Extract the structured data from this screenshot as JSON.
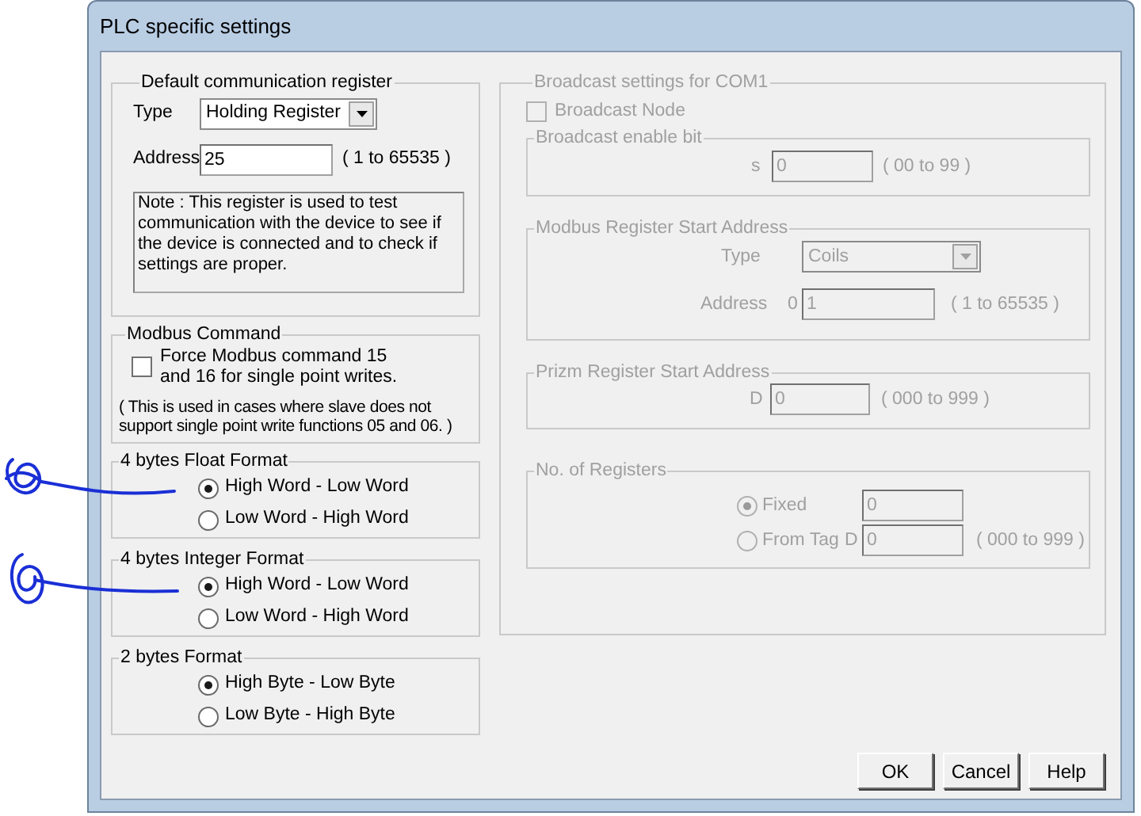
{
  "window": {
    "title": "PLC specific settings"
  },
  "default_register": {
    "title": "Default communication register",
    "type_label": "Type",
    "type_value": "Holding Register",
    "address_label": "Address",
    "address_value": "25",
    "address_range": "( 1 to 65535 )",
    "note": "Note : This register is used to test communication with the device to see if the device is connected and to check if settings are proper."
  },
  "modbus_command": {
    "title": "Modbus Command",
    "checkbox_label": "Force Modbus command 15 and 16 for single point writes.",
    "checked": false,
    "note": "( This is used in cases where slave does not support single point write functions 05 and 06. )"
  },
  "format_groups": [
    {
      "title": "4 bytes Float Format",
      "options": [
        {
          "label": "High Word - Low Word",
          "selected": true
        },
        {
          "label": "Low Word - High Word",
          "selected": false
        }
      ]
    },
    {
      "title": "4 bytes Integer Format",
      "options": [
        {
          "label": "High Word - Low Word",
          "selected": true
        },
        {
          "label": "Low Word - High Word",
          "selected": false
        }
      ]
    },
    {
      "title": "2 bytes Format",
      "options": [
        {
          "label": "High Byte - Low Byte",
          "selected": true
        },
        {
          "label": "Low Byte - High Byte",
          "selected": false
        }
      ]
    }
  ],
  "broadcast": {
    "title": "Broadcast settings for COM1",
    "disabled": true,
    "node_label": "Broadcast Node",
    "node_checked": false,
    "enable_bit": {
      "title": "Broadcast enable bit",
      "prefix": "s",
      "value": "0",
      "range": "( 00 to 99 )"
    },
    "modbus_start": {
      "title": "Modbus Register Start Address",
      "type_label": "Type",
      "type_value": "Coils",
      "address_label": "Address",
      "prefix": "0",
      "value": "1",
      "range": "( 1 to 65535 )"
    },
    "prizm_start": {
      "title": "Prizm Register Start Address",
      "prefix": "D",
      "value": "0",
      "range": "( 000 to 999 )"
    },
    "registers": {
      "title": "No. of Registers",
      "options": [
        {
          "label": "Fixed",
          "selected": true,
          "value": "0"
        },
        {
          "label": "From Tag",
          "selected": false,
          "prefix": "D",
          "value": "0",
          "range": "( 000 to 999 )"
        }
      ]
    }
  },
  "buttons": [
    "OK",
    "Cancel",
    "Help"
  ]
}
